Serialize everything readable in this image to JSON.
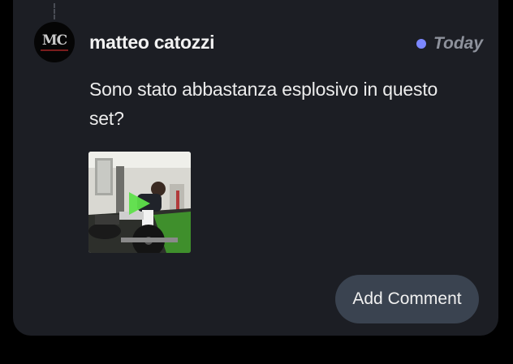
{
  "post": {
    "author": "matteo catozzi",
    "avatar_initials": "MC",
    "status_label": "Today",
    "status_color": "#7b87ff",
    "message": "Sono stato abbastanza esplosivo in questo set?",
    "attachment_icon": "play-icon",
    "play_color": "#5ee04a"
  },
  "actions": {
    "add_comment_label": "Add Comment"
  }
}
